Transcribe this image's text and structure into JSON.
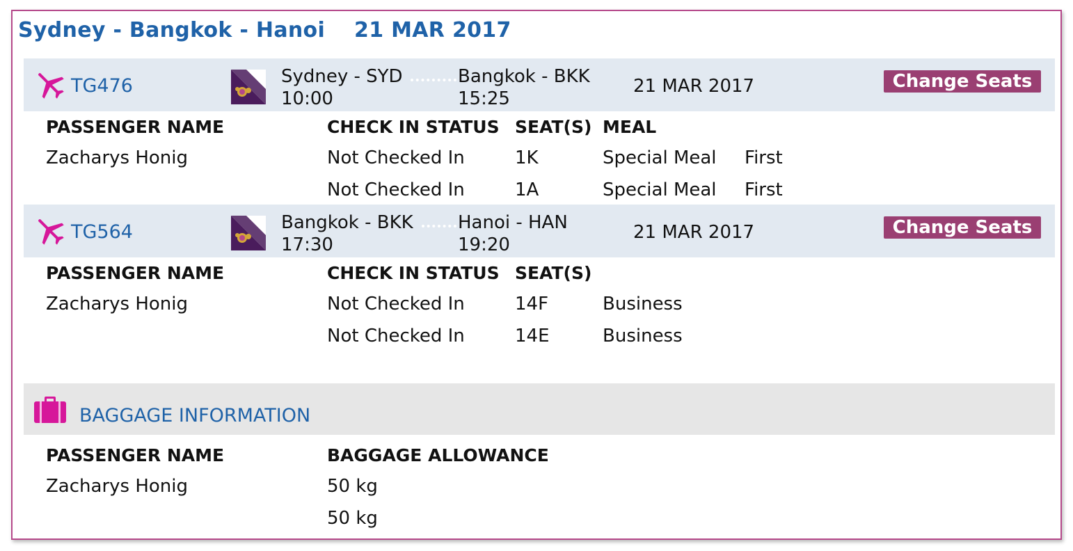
{
  "trip": {
    "route": "Sydney - Bangkok - Hanoi",
    "date": "21 MAR 2017"
  },
  "colors": {
    "accent_blue": "#1f62a8",
    "button": "#9a3f72",
    "border": "#b5488a",
    "icon_pink": "#d6179a",
    "band": "#e2e9f1"
  },
  "icons": {
    "flight": "plane-icon",
    "airline": "thai-airways-logo",
    "baggage": "suitcase-icon"
  },
  "flights": [
    {
      "number": "TG476",
      "origin": "Sydney - SYD",
      "depart_time": "10:00",
      "destination": "Bangkok - BKK",
      "arrive_time": "15:25",
      "date": "21 MAR 2017",
      "change_seats_label": "Change Seats",
      "headers": {
        "name": "PASSENGER NAME",
        "status": "CHECK IN STATUS",
        "seats": "SEAT(S)",
        "meal": "MEAL"
      },
      "passenger": "Zacharys Honig",
      "rows": [
        {
          "status": "Not Checked In",
          "seat": "1K",
          "meal": "Special Meal",
          "cabin": "First"
        },
        {
          "status": "Not Checked In",
          "seat": "1A",
          "meal": "Special Meal",
          "cabin": "First"
        }
      ]
    },
    {
      "number": "TG564",
      "origin": "Bangkok - BKK",
      "depart_time": "17:30",
      "destination": "Hanoi - HAN",
      "arrive_time": "19:20",
      "date": "21 MAR 2017",
      "change_seats_label": "Change Seats",
      "headers": {
        "name": "PASSENGER NAME",
        "status": "CHECK IN STATUS",
        "seats": "SEAT(S)"
      },
      "passenger": "Zacharys Honig",
      "rows": [
        {
          "status": "Not Checked In",
          "seat": "14F",
          "cabin": "Business"
        },
        {
          "status": "Not Checked In",
          "seat": "14E",
          "cabin": "Business"
        }
      ]
    }
  ],
  "baggage": {
    "title": "BAGGAGE INFORMATION",
    "headers": {
      "name": "PASSENGER NAME",
      "allowance": "BAGGAGE ALLOWANCE"
    },
    "passenger": "Zacharys Honig",
    "allowances": [
      "50 kg",
      "50 kg"
    ]
  }
}
